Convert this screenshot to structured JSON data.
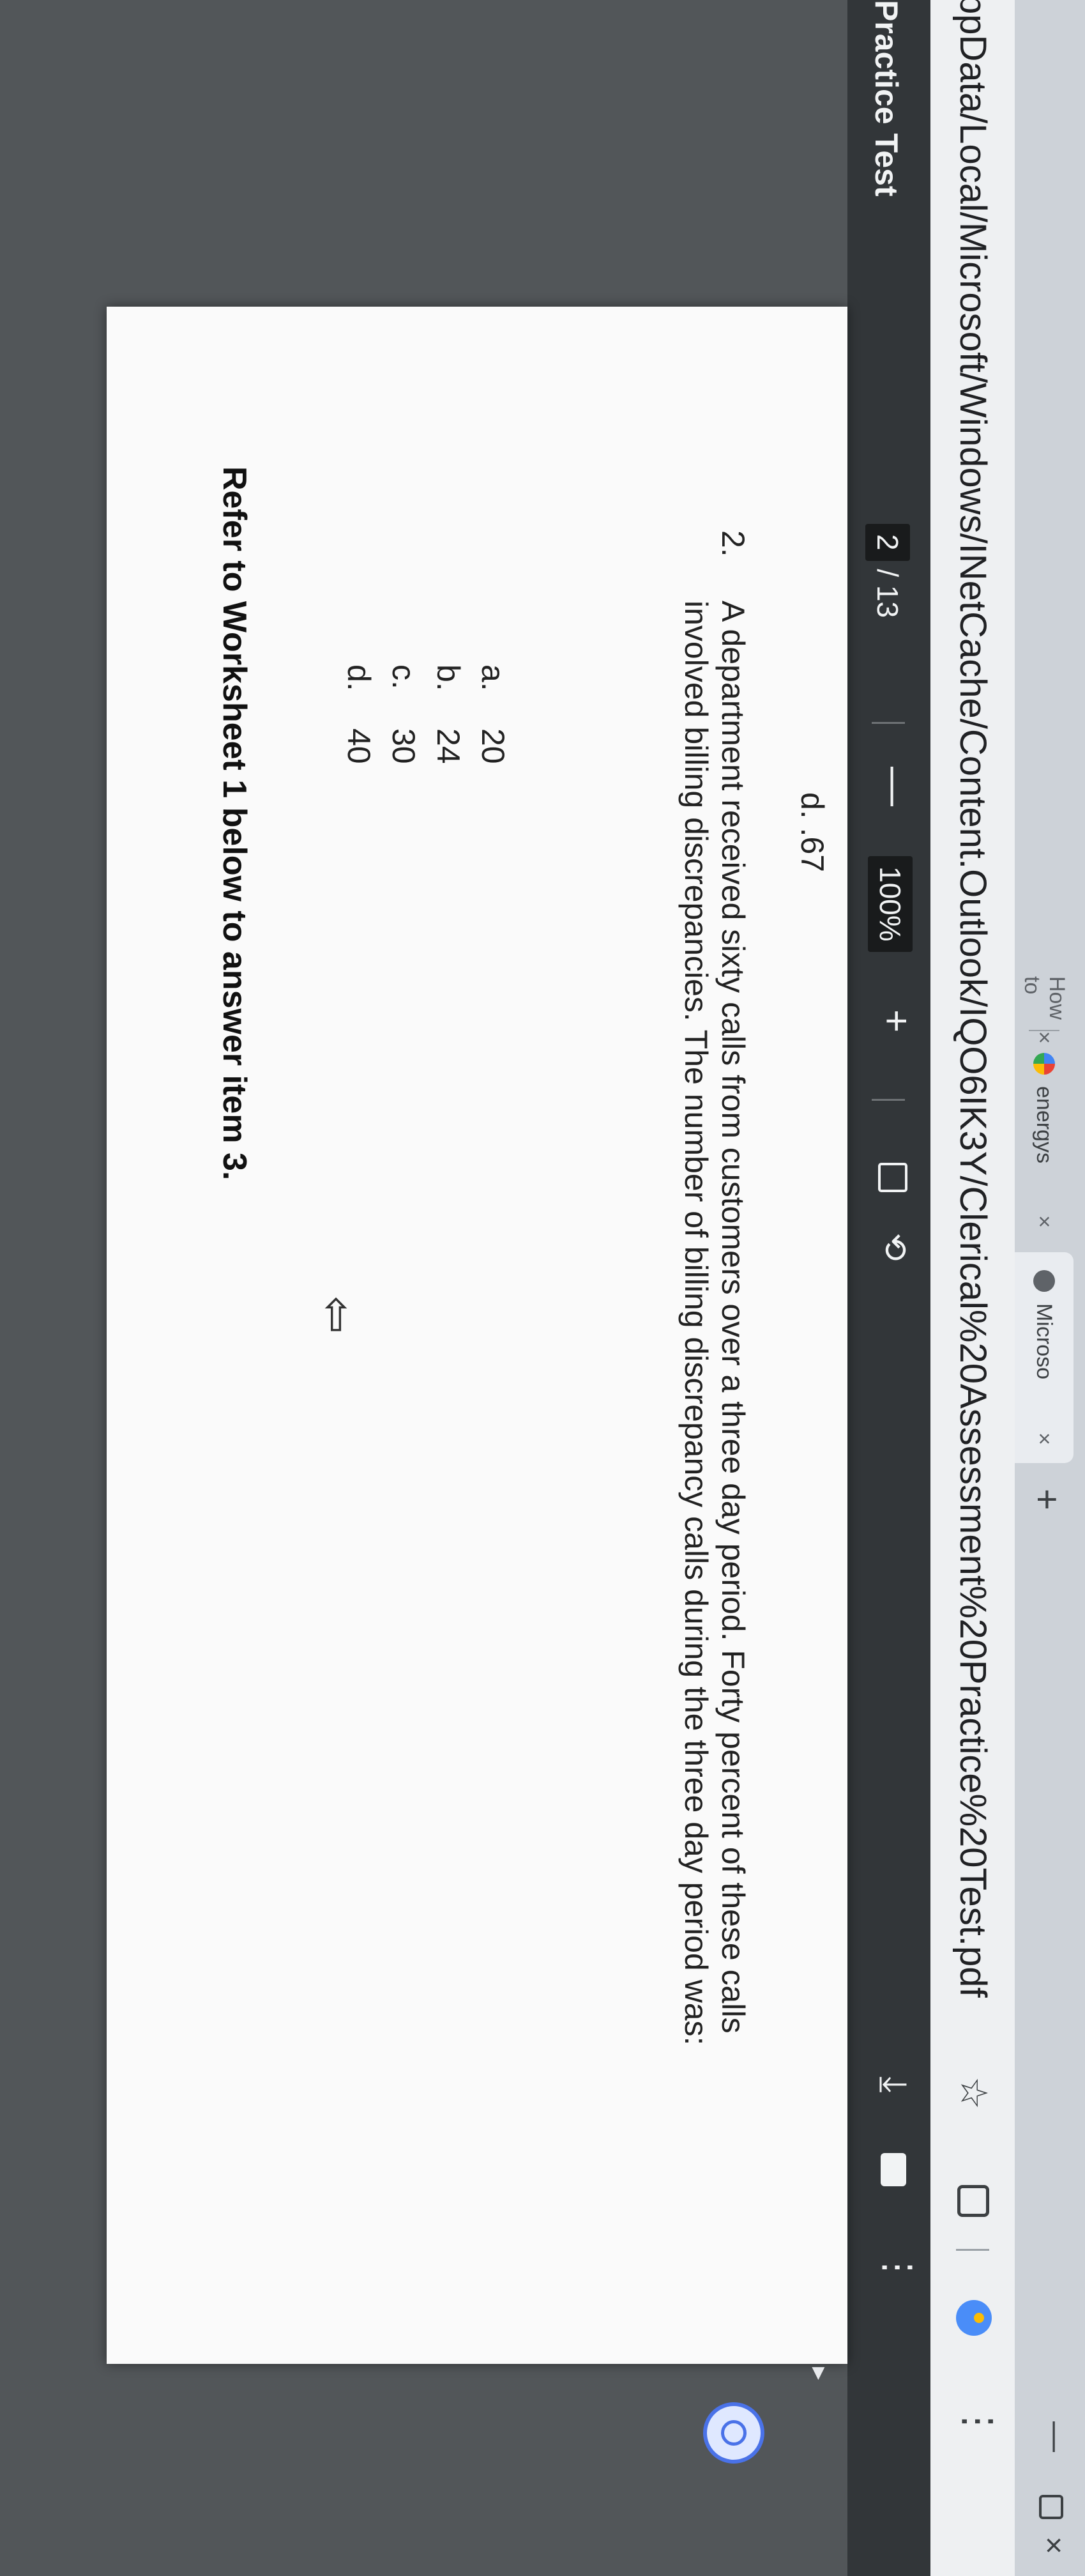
{
  "browser": {
    "tabs": [
      {
        "label": "How to"
      },
      {
        "label": "energys"
      },
      {
        "label": "Microso"
      }
    ],
    "tab_close_glyph": "×",
    "new_tab_glyph": "+",
    "window_controls": {
      "minimize": "—",
      "close": "×"
    },
    "url": "ppData/Local/Microsoft/Windows/INetCache/Content.Outlook/IQO6IK3Y/Clerical%20Assessment%20Practice%20Test.pdf",
    "menu_glyph": "⋮"
  },
  "pdf_toolbar": {
    "title": "Practice Test",
    "page_current": "2",
    "page_total": "/ 13",
    "zoom_out": "—",
    "zoom": "100%",
    "zoom_in": "+",
    "menu_glyph": "⋮"
  },
  "document": {
    "previous_option": "d.  .67",
    "question_number": "2.",
    "question_text": "A department received sixty calls from customers over a three day period. Forty percent of these calls involved billing discrepancies. The number of billing discrepancy calls during the three day period was:",
    "options": [
      {
        "letter": "a.",
        "value": "20"
      },
      {
        "letter": "b.",
        "value": "24"
      },
      {
        "letter": "c.",
        "value": "30"
      },
      {
        "letter": "d.",
        "value": "40"
      }
    ],
    "refer_text": "Refer to Worksheet 1 below to answer item 3."
  },
  "icons": {
    "star": "☆",
    "rotate": "⟲",
    "download": "⤓",
    "cursor": "⇧",
    "chevron": "▸"
  },
  "colors": {
    "toolbar": "#323639",
    "viewer_bg": "#525659",
    "page": "#fafafa",
    "accent": "#4a72e8"
  }
}
